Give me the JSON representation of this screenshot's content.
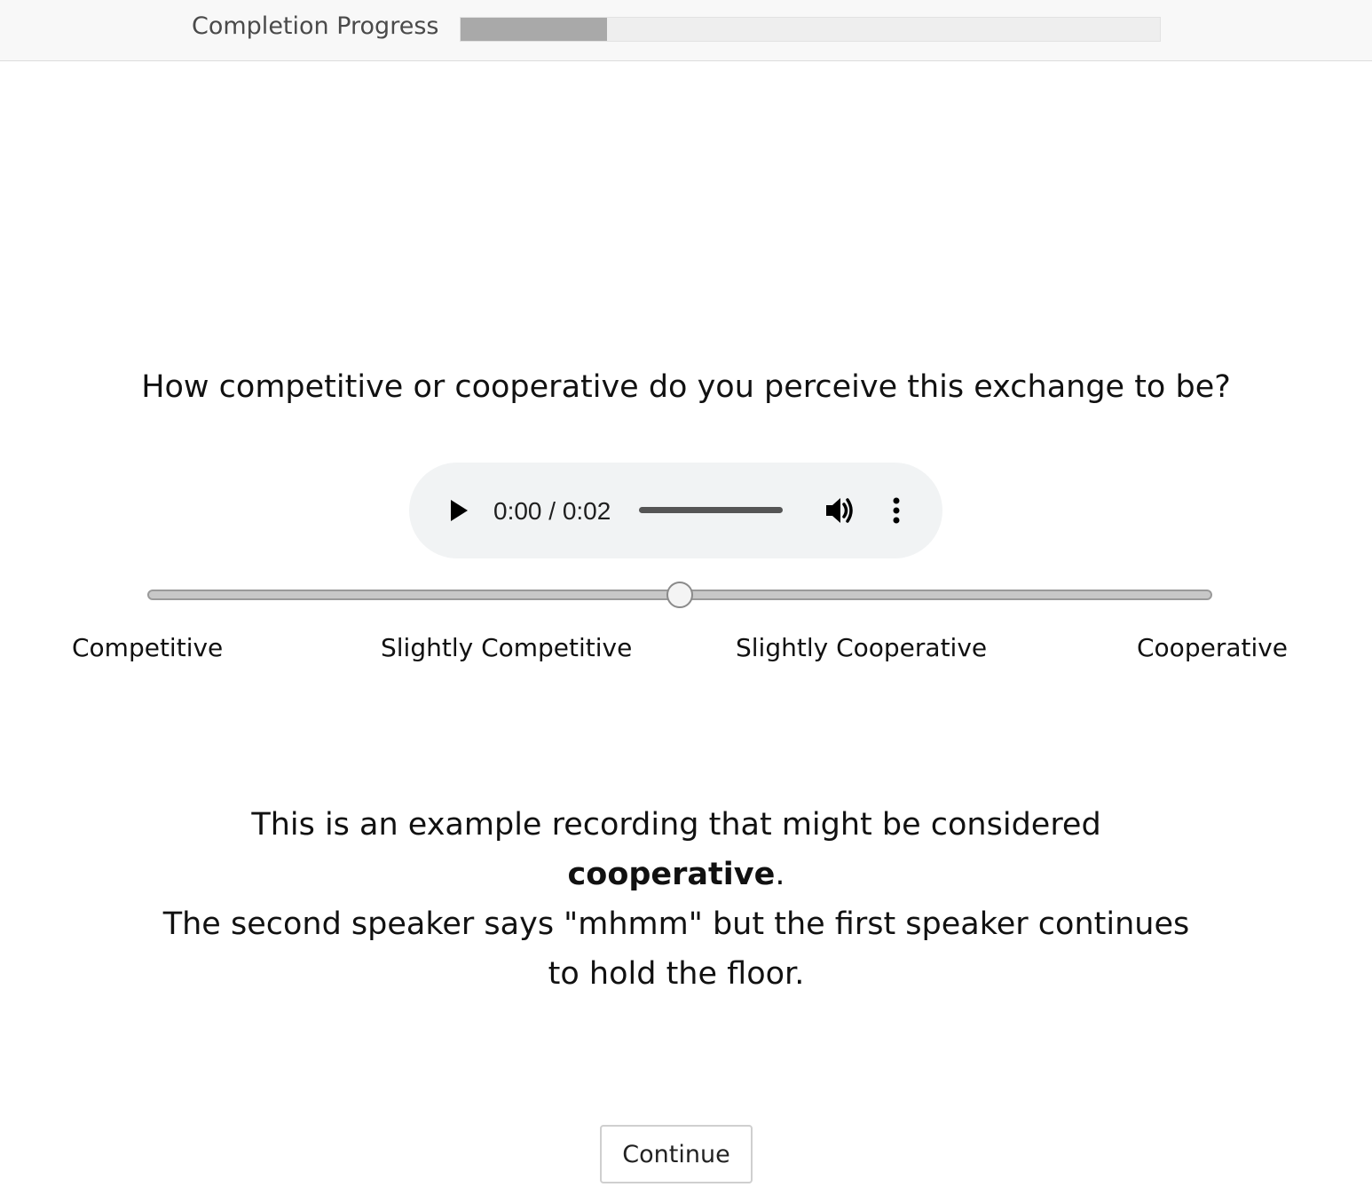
{
  "header": {
    "progress_label": "Completion Progress",
    "progress_fraction": 0.21
  },
  "question": {
    "text": "How competitive or cooperative do you perceive this exchange to be?"
  },
  "audio_player": {
    "time_display": "0:00 / 0:02",
    "play_icon": "play-icon",
    "volume_icon": "volume-icon",
    "menu_icon": "more-vertical-icon"
  },
  "rating_slider": {
    "value_fraction": 0.5,
    "labels": [
      "Competitive",
      "Slightly Competitive",
      "Slightly Cooperative",
      "Cooperative"
    ]
  },
  "explanation": {
    "part1": "This is an example recording that might be considered ",
    "emphasis": "cooperative",
    "part2": ".",
    "line2": "The second speaker says \"mhmm\" but the first speaker continues to hold the floor."
  },
  "footer": {
    "continue_label": "Continue"
  }
}
